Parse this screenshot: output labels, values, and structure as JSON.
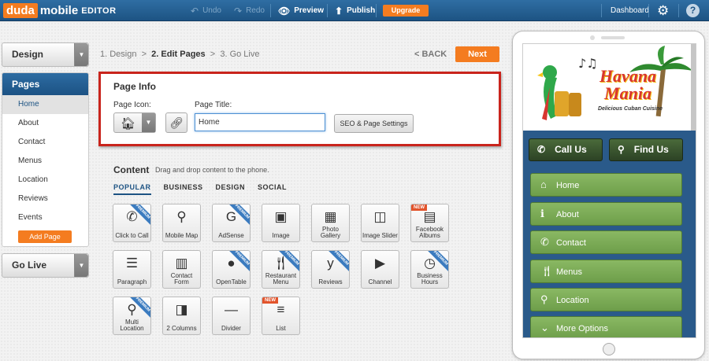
{
  "topbar": {
    "logo_duda": "duda",
    "logo_mobile": "mobile",
    "logo_editor": "EDITOR",
    "undo": "Undo",
    "redo": "Redo",
    "preview": "Preview",
    "publish": "Publish",
    "upgrade": "Upgrade",
    "dashboard": "Dashboard",
    "help": "?"
  },
  "sidebar": {
    "design_label": "Design",
    "pages_header": "Pages",
    "pages": [
      "Home",
      "About",
      "Contact",
      "Menus",
      "Location",
      "Reviews",
      "Events"
    ],
    "add_page": "Add Page",
    "golive_label": "Go Live"
  },
  "steps": {
    "step1": "1. Design",
    "sep": ">",
    "step2": "2. Edit Pages",
    "step3": "3. Go Live",
    "back": "< BACK",
    "next": "Next"
  },
  "page_info": {
    "title": "Page Info",
    "icon_label": "Page Icon:",
    "title_label": "Page Title:",
    "title_value": "Home",
    "seo_button": "SEO & Page Settings"
  },
  "content": {
    "heading": "Content",
    "subtitle": "Drag and drop content to the phone.",
    "tabs": [
      "POPULAR",
      "BUSINESS",
      "DESIGN",
      "SOCIAL"
    ],
    "widgets": [
      {
        "label": "Click to Call",
        "icon": "phone-icon",
        "badge": "PREMIUM"
      },
      {
        "label": "Mobile Map",
        "icon": "map-pin-icon",
        "badge": ""
      },
      {
        "label": "AdSense",
        "icon": "google-icon",
        "badge": "PREMIUM"
      },
      {
        "label": "Image",
        "icon": "image-icon",
        "badge": ""
      },
      {
        "label": "Photo Gallery",
        "icon": "gallery-icon",
        "badge": ""
      },
      {
        "label": "Image Slider",
        "icon": "slider-icon",
        "badge": ""
      },
      {
        "label": "Facebook Albums",
        "icon": "facebook-albums-icon",
        "badge": "NEW"
      },
      {
        "label": "Paragraph",
        "icon": "paragraph-icon",
        "badge": ""
      },
      {
        "label": "Contact Form",
        "icon": "form-icon",
        "badge": ""
      },
      {
        "label": "OpenTable",
        "icon": "opentable-icon",
        "badge": "PREMIUM"
      },
      {
        "label": "Restaurant Menu",
        "icon": "fork-knife-icon",
        "badge": "PREMIUM"
      },
      {
        "label": "Reviews",
        "icon": "yelp-icon",
        "badge": "PREMIUM"
      },
      {
        "label": "Channel",
        "icon": "youtube-icon",
        "badge": ""
      },
      {
        "label": "Business Hours",
        "icon": "clock-icon",
        "badge": "PREMIUM"
      },
      {
        "label": "Multi Location",
        "icon": "multi-pin-icon",
        "badge": "PREMIUM"
      },
      {
        "label": "2 Columns",
        "icon": "columns-icon",
        "badge": ""
      },
      {
        "label": "Divider",
        "icon": "divider-icon",
        "badge": ""
      },
      {
        "label": "List",
        "icon": "list-icon",
        "badge": "NEW"
      }
    ]
  },
  "phone": {
    "logo_line1": "Havana",
    "logo_line2": "Mania",
    "logo_tagline": "Delicious Cuban Cuisine",
    "call_us": "Call Us",
    "find_us": "Find Us",
    "menu": [
      "Home",
      "About",
      "Contact",
      "Menus",
      "Location",
      "More Options"
    ],
    "colors": {
      "menu_green": "#7aa956",
      "dark_green": "#3a5530",
      "bar_blue": "#2a5a8a"
    }
  }
}
